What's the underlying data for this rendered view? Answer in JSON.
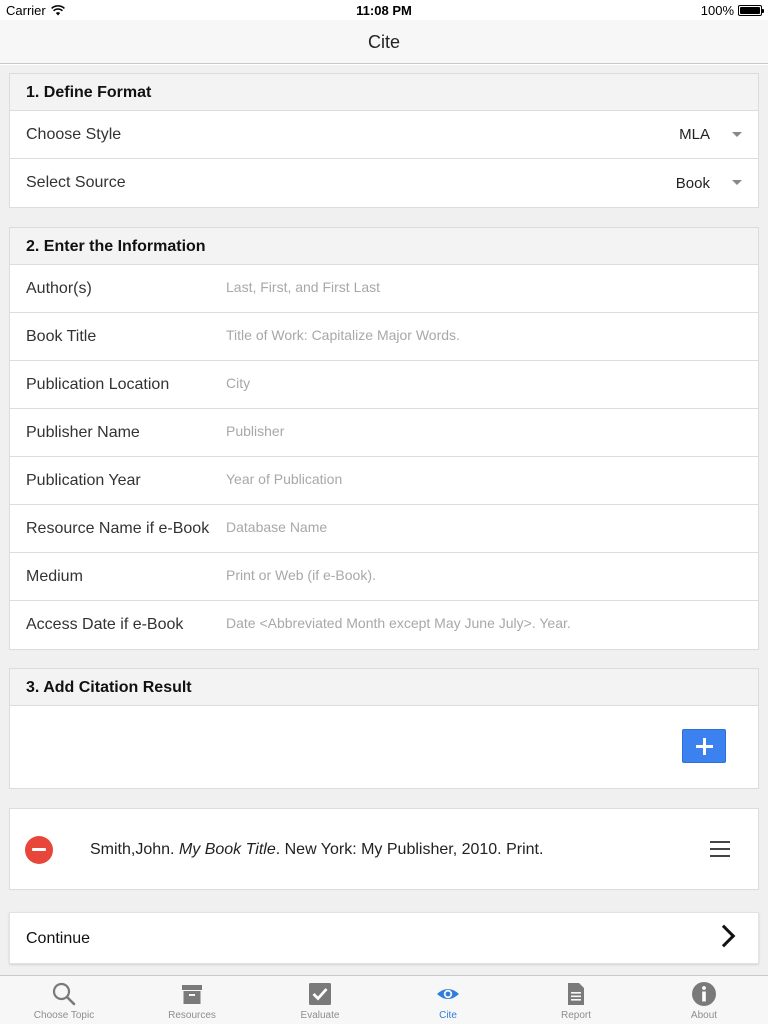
{
  "status_bar": {
    "carrier": "Carrier",
    "time": "11:08 PM",
    "battery": "100%"
  },
  "nav": {
    "title": "Cite"
  },
  "sections": {
    "format": {
      "title": "1. Define Format",
      "style_label": "Choose Style",
      "style_value": "MLA",
      "source_label": "Select Source",
      "source_value": "Book"
    },
    "info": {
      "title": "2. Enter the Information",
      "fields": [
        {
          "label": "Author(s)",
          "placeholder": "Last, First, and First Last"
        },
        {
          "label": "Book Title",
          "placeholder": "Title of Work: Capitalize Major Words."
        },
        {
          "label": "Publication Location",
          "placeholder": "City"
        },
        {
          "label": "Publisher Name",
          "placeholder": "Publisher"
        },
        {
          "label": "Publication Year",
          "placeholder": "Year of Publication"
        },
        {
          "label": "Resource Name if e-Book",
          "placeholder": "Database Name"
        },
        {
          "label": "Medium",
          "placeholder": "Print or Web (if e-Book)."
        },
        {
          "label": "Access Date if e-Book",
          "placeholder": "Date <Abbreviated Month except May June July>. Year."
        }
      ]
    },
    "result": {
      "title": "3. Add Citation Result"
    }
  },
  "citation": {
    "prefix": "Smith,John. ",
    "title": "My Book Title",
    "suffix": ". New York: My Publisher, 2010. Print."
  },
  "continue_label": "Continue",
  "tabs": [
    {
      "label": "Choose Topic",
      "icon": "search-icon"
    },
    {
      "label": "Resources",
      "icon": "archive-box-icon"
    },
    {
      "label": "Evaluate",
      "icon": "checkbox-icon"
    },
    {
      "label": "Cite",
      "icon": "eye-icon"
    },
    {
      "label": "Report",
      "icon": "document-icon"
    },
    {
      "label": "About",
      "icon": "info-icon"
    }
  ],
  "colors": {
    "accent": "#2f7de1",
    "add_button": "#3b82f0",
    "remove": "#e8463a"
  }
}
